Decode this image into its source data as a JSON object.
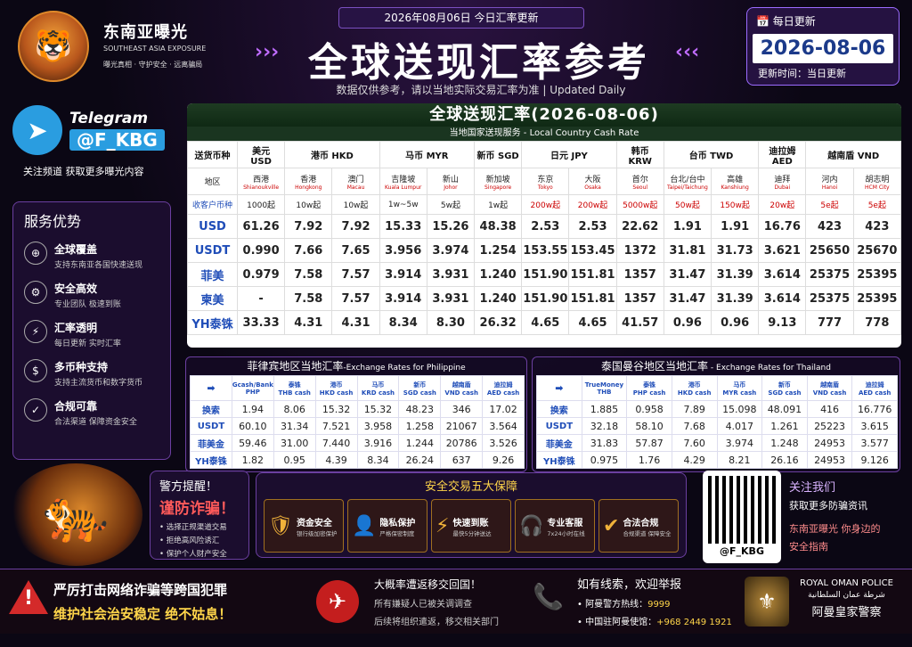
{
  "brand": {
    "title": "东南亚曝光",
    "subtitle": "SOUTHEAST ASIA EXPOSURE",
    "tagline": "曝光真相 · 守护安全 · 远离骗局"
  },
  "header": {
    "date_strip": "2026年08月06日 今日汇率更新",
    "title": "全球送现汇率参考",
    "subline": "数据仅供参考，请以当地实际交易汇率为准 | Updated Daily"
  },
  "datebox": {
    "label": "每日更新",
    "date": "2026-08-06",
    "update": "更新时间：当日更新"
  },
  "telegram": {
    "label": "Telegram",
    "handle": "@F_KBG",
    "desc": "关注频道  获取更多曝光内容"
  },
  "services": {
    "title": "服务优势",
    "items": [
      {
        "icon": "globe-icon",
        "title": "全球覆盖",
        "sub": "支持东南亚各国快速送现"
      },
      {
        "icon": "gear-icon",
        "title": "安全高效",
        "sub": "专业团队  极速到账"
      },
      {
        "icon": "runner-icon",
        "title": "汇率透明",
        "sub": "每日更新  实时汇率"
      },
      {
        "icon": "currency-icon",
        "title": "多币种支持",
        "sub": "支持主流货币和数字货币"
      },
      {
        "icon": "shield-check-icon",
        "title": "合规可靠",
        "sub": "合法渠道  保障资金安全"
      }
    ]
  },
  "main_table": {
    "title": "全球送现汇率(2026-08-06)",
    "subtitle": "当地国家送现服务 - Local Country Cash Rate",
    "col0": "送货币种",
    "row_city": "地区",
    "row_min": "收客户币种",
    "currencies": [
      {
        "label": "美元\nUSD",
        "span": 1
      },
      {
        "label": "港币  HKD",
        "span": 2
      },
      {
        "label": "马币  MYR",
        "span": 2
      },
      {
        "label": "新币 SGD",
        "span": 1
      },
      {
        "label": "日元 JPY",
        "span": 2
      },
      {
        "label": "韩币\nKRW",
        "span": 1
      },
      {
        "label": "台币  TWD",
        "span": 2
      },
      {
        "label": "迪拉姆\nAED",
        "span": 1
      },
      {
        "label": "越南盾  VND",
        "span": 2
      }
    ],
    "cities": [
      {
        "cn": "西港",
        "en": "Shianoukville"
      },
      {
        "cn": "香港",
        "en": "Hongkong"
      },
      {
        "cn": "澳门",
        "en": "Macau"
      },
      {
        "cn": "吉隆坡",
        "en": "Kuala Lumpur"
      },
      {
        "cn": "新山",
        "en": "Johor"
      },
      {
        "cn": "新加坡",
        "en": "Singapore"
      },
      {
        "cn": "东京",
        "en": "Tokyo"
      },
      {
        "cn": "大阪",
        "en": "Osaka"
      },
      {
        "cn": "首尔",
        "en": "Seoul"
      },
      {
        "cn": "台北/台中",
        "en": "Taipei/Taichung"
      },
      {
        "cn": "高雄",
        "en": "Kanshiung"
      },
      {
        "cn": "迪拜",
        "en": "Dubai"
      },
      {
        "cn": "河内",
        "en": "Hanoi"
      },
      {
        "cn": "胡志明",
        "en": "HCM City"
      }
    ],
    "mins": [
      "1000起",
      "10w起",
      "10w起",
      "1w~5w",
      "5w起",
      "1w起",
      "200w起",
      "200w起",
      "5000w起",
      "50w起",
      "150w起",
      "20w起",
      "5e起",
      "5e起"
    ],
    "rows": [
      {
        "label": "USD",
        "values": [
          "61.26",
          "7.92",
          "7.92",
          "15.33",
          "15.26",
          "48.38",
          "2.53",
          "2.53",
          "22.62",
          "1.91",
          "1.91",
          "16.76",
          "423",
          "423"
        ]
      },
      {
        "label": "USDT",
        "values": [
          "0.990",
          "7.66",
          "7.65",
          "3.956",
          "3.974",
          "1.254",
          "153.55",
          "153.45",
          "1372",
          "31.81",
          "31.73",
          "3.621",
          "25650",
          "25670"
        ]
      },
      {
        "label": "菲美",
        "values": [
          "0.979",
          "7.58",
          "7.57",
          "3.914",
          "3.931",
          "1.240",
          "151.90",
          "151.81",
          "1357",
          "31.47",
          "31.39",
          "3.614",
          "25375",
          "25395"
        ]
      },
      {
        "label": "柬美",
        "values": [
          "-",
          "7.58",
          "7.57",
          "3.914",
          "3.931",
          "1.240",
          "151.90",
          "151.81",
          "1357",
          "31.47",
          "31.39",
          "3.614",
          "25375",
          "25395"
        ]
      },
      {
        "label": "YH泰铢",
        "values": [
          "33.33",
          "4.31",
          "4.31",
          "8.34",
          "8.30",
          "26.32",
          "4.65",
          "4.65",
          "41.57",
          "0.96",
          "0.96",
          "9.13",
          "777",
          "778"
        ]
      }
    ]
  },
  "ph_table": {
    "title": "菲律宾地区当地汇率",
    "title_en": "-Exchange Rates for Philippine",
    "corner": "➡",
    "headers": [
      "Gcash/Bank\nPHP",
      "泰铢\nTHB cash",
      "港币\nHKD cash",
      "马币\nKRD cash",
      "新币\nSGD cash",
      "越南盾\nVND cash",
      "迪拉姆\nAED cash"
    ],
    "rows": [
      {
        "label": "换索",
        "values": [
          "1.94",
          "8.06",
          "15.32",
          "15.32",
          "48.23",
          "346",
          "17.02"
        ]
      },
      {
        "label": "USDT",
        "values": [
          "60.10",
          "31.34",
          "7.521",
          "3.958",
          "1.258",
          "21067",
          "3.564"
        ]
      },
      {
        "label": "菲美金",
        "values": [
          "59.46",
          "31.00",
          "7.440",
          "3.916",
          "1.244",
          "20786",
          "3.526"
        ]
      },
      {
        "label": "YH泰铢",
        "values": [
          "1.82",
          "0.95",
          "4.39",
          "8.34",
          "26.24",
          "637",
          "9.26"
        ]
      }
    ]
  },
  "th_table": {
    "title": "泰国曼谷地区当地汇率",
    "title_en": " - Exchange Rates for Thailand",
    "corner": "➡",
    "headers": [
      "TrueMoney\nTHB",
      "泰铢\nPHP cash",
      "港币\nHKD cash",
      "马币\nMYR cash",
      "新币\nSGD cash",
      "越南盾\nVND cash",
      "迪拉姆\nAED cash"
    ],
    "rows": [
      {
        "label": "换索",
        "values": [
          "1.885",
          "0.958",
          "7.89",
          "15.098",
          "48.091",
          "416",
          "16.776"
        ]
      },
      {
        "label": "USDT",
        "values": [
          "32.18",
          "58.10",
          "7.68",
          "4.017",
          "1.261",
          "25223",
          "3.615"
        ]
      },
      {
        "label": "菲美金",
        "values": [
          "31.83",
          "57.87",
          "7.60",
          "3.974",
          "1.248",
          "24953",
          "3.577"
        ]
      },
      {
        "label": "YH泰铢",
        "values": [
          "0.975",
          "1.76",
          "4.29",
          "8.21",
          "26.16",
          "24953",
          "9.126"
        ]
      }
    ]
  },
  "warning": {
    "title": "警方提醒！",
    "big": "谨防诈骗！",
    "items": [
      "选择正规渠道交易",
      "拒绝高风险诱汇",
      "保护个人财产安全"
    ]
  },
  "guarantee": {
    "title": "安全交易五大保障",
    "items": [
      {
        "icon": "shield-icon",
        "title": "资金安全",
        "sub": "银行级加密保护"
      },
      {
        "icon": "person-icon",
        "title": "隐私保护",
        "sub": "严格保密制度"
      },
      {
        "icon": "lightning-icon",
        "title": "快速到账",
        "sub": "最快5分钟送达"
      },
      {
        "icon": "headset-icon",
        "title": "专业客服",
        "sub": "7x24小时在线"
      },
      {
        "icon": "check-icon",
        "title": "合法合规",
        "sub": "合规渠道 保障安全"
      }
    ]
  },
  "qr": {
    "handle": "@F_KBG"
  },
  "follow": {
    "title": "关注我们",
    "sub": "获取更多防骗资讯",
    "extra1": "东南亚曝光 你身边的",
    "extra2": "安全指南"
  },
  "footer": {
    "left1": "严厉打击网络诈骗等跨国犯罪",
    "left2": "维护社会治安稳定  绝不姑息！",
    "mid1": "大概率遭返移交回国！",
    "mid2": "所有嫌疑人已被关调调查",
    "mid3": "后续将组织遣返，移交相关部门",
    "r1": "如有线索，欢迎举报",
    "r2": "• 阿曼警方热线：",
    "r2v": "9999",
    "r3": "• 中国驻阿曼使馆：",
    "r3v": "+968 2449 1921",
    "police_en": "ROYAL OMAN POLICE",
    "police_ar": "شرطة عمان السلطانية",
    "police_cn": "阿曼皇家警察"
  }
}
